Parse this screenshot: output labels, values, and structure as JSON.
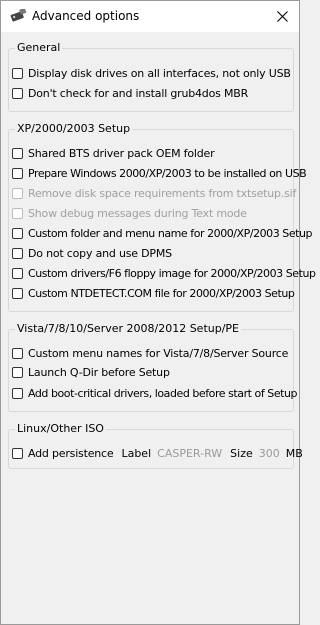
{
  "window": {
    "title": "Advanced options",
    "icon": "usb-drive-icon",
    "close": "close-icon"
  },
  "groups": {
    "general": {
      "title": "General",
      "items": [
        {
          "label": "Display disk drives on all interfaces, not only USB",
          "checked": false,
          "enabled": true
        },
        {
          "label": "Don't check for and install grub4dos MBR",
          "checked": false,
          "enabled": true
        }
      ]
    },
    "xp": {
      "title": "XP/2000/2003 Setup",
      "items": [
        {
          "label": "Shared BTS driver pack OEM folder",
          "checked": false,
          "enabled": true
        },
        {
          "label": "Prepare Windows 2000/XP/2003 to be installed on USB",
          "checked": false,
          "enabled": true
        },
        {
          "label": "Remove disk space requirements from txtsetup.sif",
          "checked": false,
          "enabled": false
        },
        {
          "label": "Show debug messages during Text mode",
          "checked": false,
          "enabled": false
        },
        {
          "label": "Custom folder and menu name for 2000/XP/2003 Setup",
          "checked": false,
          "enabled": true
        },
        {
          "label": "Do not copy and use DPMS",
          "checked": false,
          "enabled": true
        },
        {
          "label": "Custom drivers/F6 floppy image for 2000/XP/2003 Setup",
          "checked": false,
          "enabled": true
        },
        {
          "label": "Custom NTDETECT.COM file for 2000/XP/2003 Setup",
          "checked": false,
          "enabled": true
        }
      ]
    },
    "vista": {
      "title": "Vista/7/8/10/Server 2008/2012 Setup/PE",
      "items": [
        {
          "label": "Custom menu names for Vista/7/8/Server Source",
          "checked": false,
          "enabled": true
        },
        {
          "label": "Launch Q-Dir before Setup",
          "checked": false,
          "enabled": true
        },
        {
          "label": "Add boot-critical drivers, loaded before start of Setup",
          "checked": false,
          "enabled": true
        }
      ]
    },
    "linux": {
      "title": "Linux/Other ISO",
      "persistence": {
        "label": "Add persistence",
        "checked": false,
        "label_caption": "Label",
        "label_value": "CASPER-RW",
        "size_caption": "Size",
        "size_value": "300",
        "size_unit": "MB"
      }
    }
  }
}
